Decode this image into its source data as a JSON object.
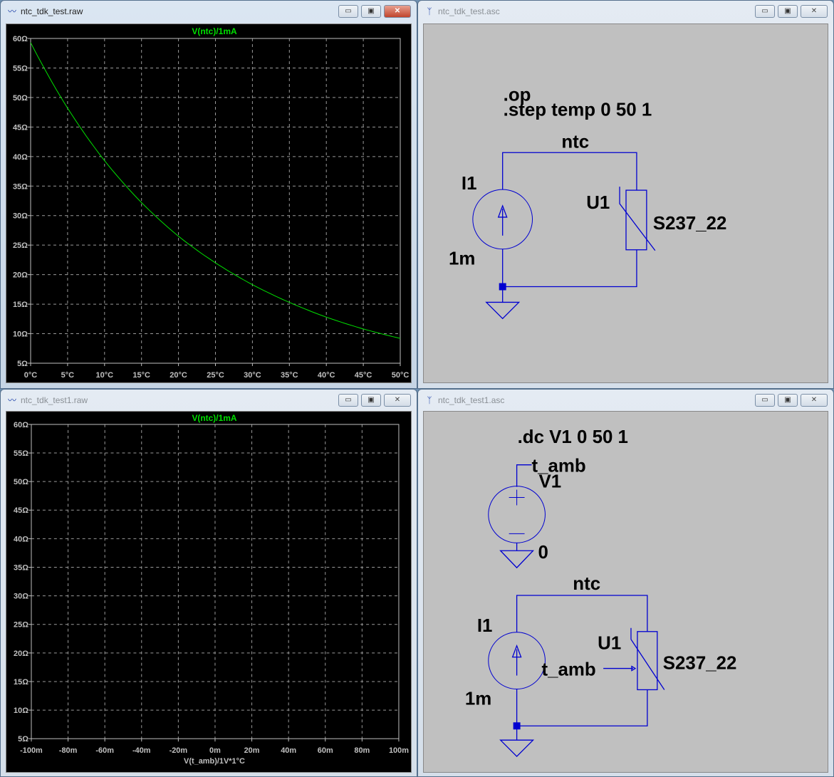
{
  "windows": [
    {
      "title": "ntc_tdk_test.raw",
      "icon": "waveform-icon",
      "active": true
    },
    {
      "title": "ntc_tdk_test.asc",
      "icon": "schematic-icon",
      "active": false
    },
    {
      "title": "ntc_tdk_test1.raw",
      "icon": "waveform-icon",
      "active": false
    },
    {
      "title": "ntc_tdk_test1.asc",
      "icon": "schematic-icon",
      "active": false
    }
  ],
  "buttons": {
    "minimize": "▭",
    "restore": "▣",
    "close": "✕"
  },
  "colors": {
    "trace": "#00e000",
    "plot_bg": "#000000",
    "grid": "#9a9a9a",
    "wire": "#0000d0",
    "schematic_bg": "#c0c0c0"
  },
  "chart_data": [
    {
      "type": "line",
      "title": "V(ntc)/1mA",
      "xlabel": "",
      "ylabel": "",
      "x": [
        0,
        5,
        10,
        15,
        20,
        25,
        30,
        35,
        40,
        45,
        50
      ],
      "series": [
        {
          "name": "V(ntc)/1mA",
          "values": [
            59.3,
            48.2,
            39.3,
            32.2,
            26.5,
            22.0,
            18.3,
            15.3,
            12.8,
            10.8,
            9.2
          ]
        }
      ],
      "xlim": [
        0,
        50
      ],
      "ylim": [
        5,
        60
      ],
      "xticks": [
        "0°C",
        "5°C",
        "10°C",
        "15°C",
        "20°C",
        "25°C",
        "30°C",
        "35°C",
        "40°C",
        "45°C",
        "50°C"
      ],
      "yticks": [
        "5Ω",
        "10Ω",
        "15Ω",
        "20Ω",
        "25Ω",
        "30Ω",
        "35Ω",
        "40Ω",
        "45Ω",
        "50Ω",
        "55Ω",
        "60Ω"
      ],
      "grid": true
    },
    {
      "type": "line",
      "title": "V(ntc)/1mA",
      "xlabel": "V(t_amb)/1V*1°C",
      "ylabel": "",
      "x": [],
      "series": [
        {
          "name": "V(ntc)/1mA",
          "values": []
        }
      ],
      "xlim": [
        -100,
        100
      ],
      "ylim": [
        5,
        60
      ],
      "xticks": [
        "-100m",
        "-80m",
        "-60m",
        "-40m",
        "-20m",
        "0m",
        "20m",
        "40m",
        "60m",
        "80m",
        "100m"
      ],
      "yticks": [
        "5Ω",
        "10Ω",
        "15Ω",
        "20Ω",
        "25Ω",
        "30Ω",
        "35Ω",
        "40Ω",
        "45Ω",
        "50Ω",
        "55Ω",
        "60Ω"
      ],
      "grid": true
    }
  ],
  "schematic1": {
    "directive1": ".op",
    "directive2": ".step temp 0 50 1",
    "net": "ntc",
    "src_name": "I1",
    "src_value": "1m",
    "part_name": "U1",
    "part_value": "S237_22"
  },
  "schematic2": {
    "directive": ".dc V1 0 50 1",
    "vsrc_net": "t_amb",
    "vsrc_name": "V1",
    "gnd_label": "0",
    "net": "ntc",
    "src_name": "I1",
    "src_value": "1m",
    "part_name": "U1",
    "part_value": "S237_22",
    "input_net": "t_amb"
  }
}
